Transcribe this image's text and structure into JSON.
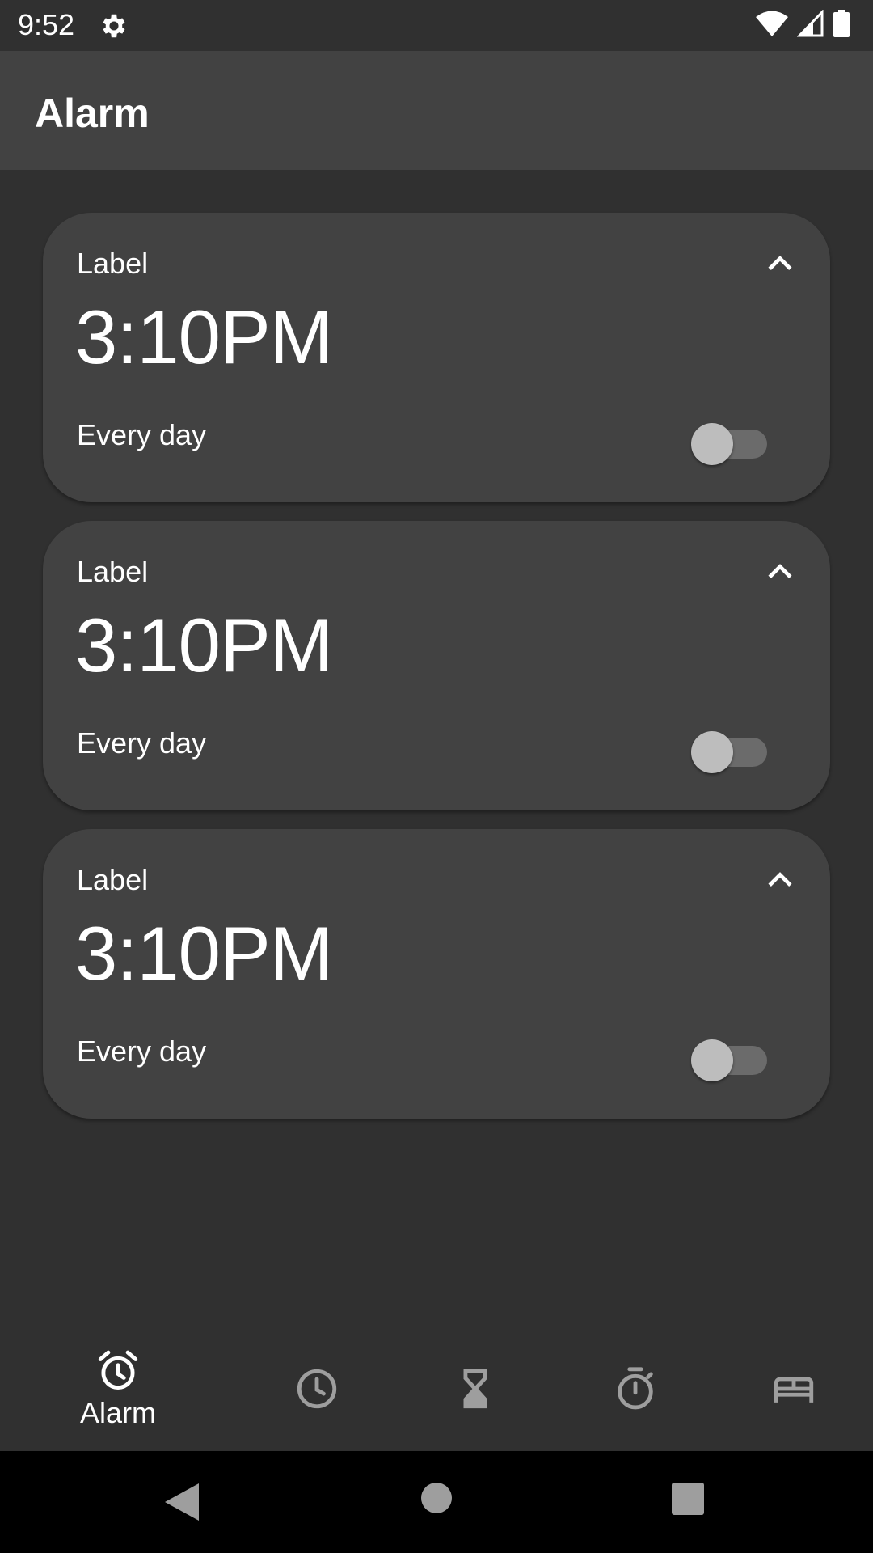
{
  "status_bar": {
    "time": "9:52"
  },
  "app_bar": {
    "title": "Alarm"
  },
  "alarms": [
    {
      "label": "Label",
      "time": "3:10PM",
      "repeat": "Every day",
      "enabled": false
    },
    {
      "label": "Label",
      "time": "3:10PM",
      "repeat": "Every day",
      "enabled": false
    },
    {
      "label": "Label",
      "time": "3:10PM",
      "repeat": "Every day",
      "enabled": false
    }
  ],
  "bottom_nav": {
    "items": [
      {
        "icon": "alarm-icon",
        "label": "Alarm",
        "selected": true
      },
      {
        "icon": "clock-icon",
        "label": "",
        "selected": false
      },
      {
        "icon": "hourglass-icon",
        "label": "",
        "selected": false
      },
      {
        "icon": "stopwatch-icon",
        "label": "",
        "selected": false
      },
      {
        "icon": "bed-icon",
        "label": "",
        "selected": false
      }
    ]
  },
  "system_nav": {
    "icons": [
      "back-icon",
      "home-icon",
      "recents-icon"
    ]
  },
  "colors": {
    "background": "#303030",
    "surface": "#424242",
    "toggle_track": "#6b6b6b",
    "toggle_thumb": "#bdbdbd",
    "inactive_icon": "#9e9e9e"
  }
}
